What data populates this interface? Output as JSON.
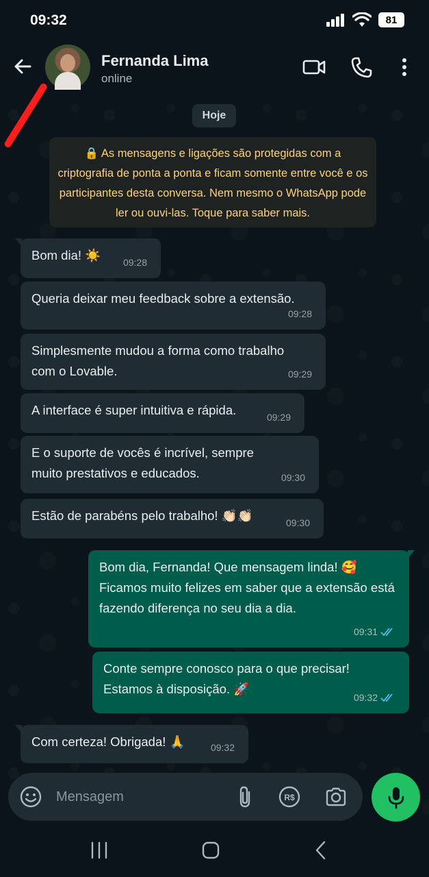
{
  "status_bar": {
    "time": "09:32",
    "battery": "81"
  },
  "header": {
    "contact_name": "Fernanda Lima",
    "contact_status": "online",
    "icons": [
      "back-arrow-icon",
      "video-call-icon",
      "phone-icon",
      "more-vert-icon"
    ]
  },
  "chat": {
    "date_chip": "Hoje",
    "encryption_notice": "🔒 As mensagens e ligações são protegidas com a criptografia de ponta a ponta e ficam somente entre você e os participantes desta conversa. Nem mesmo o WhatsApp pode ler ou ouvi-las. Toque para saber mais.",
    "messages": [
      {
        "direction": "in",
        "text": "Bom dia! ☀️",
        "time": "09:28"
      },
      {
        "direction": "in",
        "text": "Queria deixar meu feedback sobre a extensão.",
        "time": "09:28"
      },
      {
        "direction": "in",
        "text": "Simplesmente mudou a forma como trabalho com o Lovable.",
        "time": "09:29"
      },
      {
        "direction": "in",
        "text": "A interface é super intuitiva e rápida.",
        "time": "09:29"
      },
      {
        "direction": "in",
        "text": "E o suporte de vocês é incrível, sempre muito prestativos e educados.",
        "time": "09:30"
      },
      {
        "direction": "in",
        "text": "Estão de parabéns pelo trabalho! 👏🏻👏🏻",
        "time": "09:30"
      },
      {
        "direction": "out",
        "text": "Bom dia, Fernanda! Que mensagem linda! 🥰 Ficamos muito felizes em saber que a extensão está fazendo diferença no seu dia a dia.",
        "time": "09:31",
        "status": "read"
      },
      {
        "direction": "out",
        "text": "Conte sempre conosco para o que precisar! Estamos à disposição. 🚀",
        "time": "09:32",
        "status": "read"
      },
      {
        "direction": "in",
        "text": "Com certeza! Obrigada! 🙏",
        "time": "09:32"
      }
    ]
  },
  "composer": {
    "placeholder": "Mensagem",
    "icons": [
      "emoji-icon",
      "attach-icon",
      "payment-icon",
      "camera-icon",
      "mic-icon"
    ]
  },
  "colors": {
    "background": "#0b141a",
    "incoming_bubble": "#1f2c33",
    "outgoing_bubble": "#005c4b",
    "notice_text": "#ffd279",
    "accent": "#21c063",
    "read_tick": "#53bdeb"
  }
}
